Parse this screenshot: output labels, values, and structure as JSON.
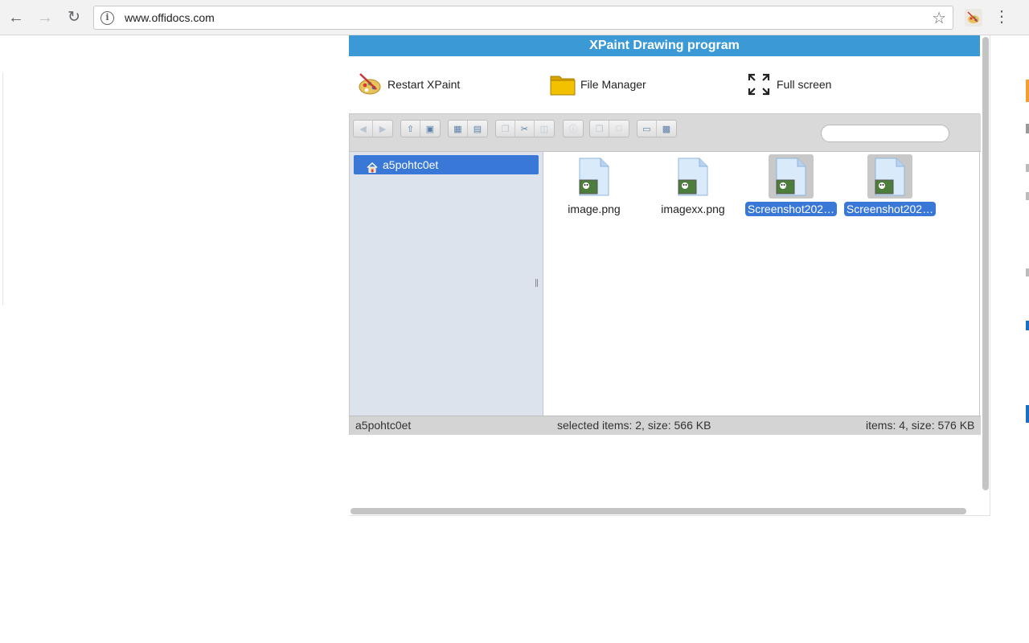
{
  "browser": {
    "back_icon": "arrow-left-icon",
    "forward_icon": "arrow-right-icon",
    "reload_icon": "reload-icon",
    "url": "www.offidocs.com",
    "menu_icon": "vertical-dots-icon"
  },
  "app": {
    "title": "XPaint Drawing program",
    "title_bar_color": "#3b9ad6",
    "actions": {
      "restart_label": "Restart XPaint",
      "file_manager_label": "File Manager",
      "full_screen_label": "Full screen"
    }
  },
  "file_manager": {
    "tree": {
      "root_label": "a5pohtc0et"
    },
    "files": [
      {
        "name": "image.png",
        "selected": false
      },
      {
        "name": "imagexx.png",
        "selected": false
      },
      {
        "name": "Screenshot202…",
        "selected": true
      },
      {
        "name": "Screenshot202…",
        "selected": true
      }
    ],
    "status": {
      "path": "a5pohtc0et",
      "selection": "selected items: 2, size: 566 KB",
      "totals": "items: 4, size: 576 KB"
    },
    "selection_color": "#3a78d8"
  }
}
